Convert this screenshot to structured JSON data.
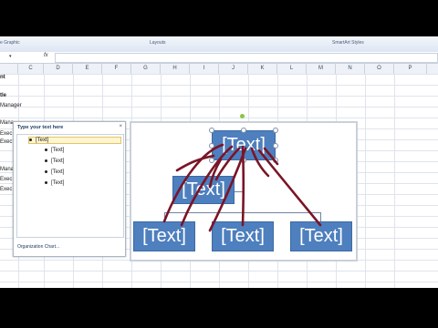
{
  "ribbon": {
    "group1": "e Graphic",
    "group2": "Layouts",
    "group3": "SmartArt Styles"
  },
  "formula_bar": {
    "namebox": "",
    "fx_label": "fx",
    "content": ""
  },
  "columns": [
    "C",
    "D",
    "E",
    "F",
    "G",
    "H",
    "I",
    "J",
    "K",
    "L",
    "M",
    "N",
    "O",
    "P"
  ],
  "sheet_cells": {
    "r1": "nt",
    "r2": "tle",
    "r3": "Manager",
    "r4": "Mana",
    "r5": "Exec",
    "r6": "Exec",
    "r7": "Mana",
    "r8": "Exec",
    "r9": "Exec"
  },
  "text_pane": {
    "title": "Type your text here",
    "close": "×",
    "items": [
      "[Text]",
      "[Text]",
      "[Text]",
      "[Text]",
      "[Text]"
    ],
    "footer": "Organization Chart..."
  },
  "smartart": {
    "top": "[Text]",
    "assistant": "[Text]",
    "children": [
      "[Text]",
      "[Text]",
      "[Text]"
    ],
    "fill_color": "#4e7fbe",
    "scribble_color": "#7a1426"
  }
}
